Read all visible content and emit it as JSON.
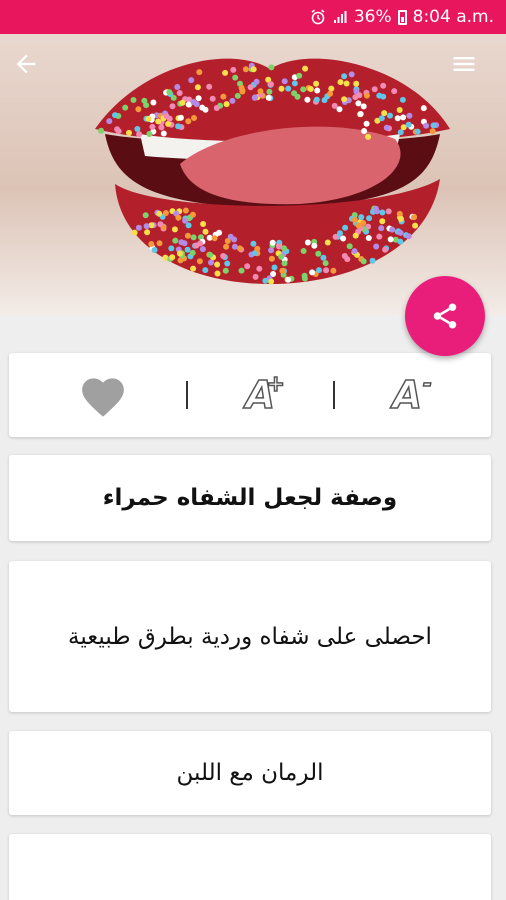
{
  "status_bar": {
    "battery_percent": "36%",
    "time": "8:04 a.m.",
    "color": "#e8175d"
  },
  "header": {
    "back_icon": "arrow-left-icon",
    "menu_icon": "hamburger-menu-icon",
    "share_icon": "share-icon",
    "accent": "#e91e7a"
  },
  "toolbar": {
    "favorite_icon": "heart-icon",
    "increase_font_icon": "font-increase-icon",
    "increase_font_label": "A",
    "increase_font_sign": "+",
    "decrease_font_icon": "font-decrease-icon",
    "decrease_font_label": "A",
    "decrease_font_sign": "-"
  },
  "content": {
    "title": "وصفة لجعل الشفاه حمراء",
    "items": [
      {
        "text": "احصلى على شفاه وردية بطرق طبيعية"
      },
      {
        "text": "الرمان مع اللبن"
      },
      {
        "text": ""
      }
    ]
  }
}
